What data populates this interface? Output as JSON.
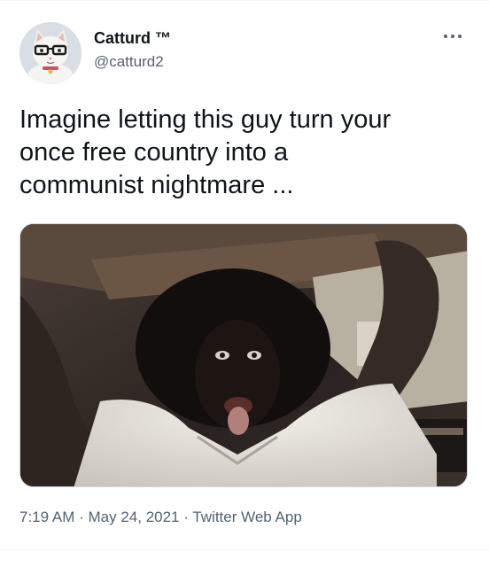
{
  "author": {
    "display_name": "Catturd ™",
    "handle": "@catturd2",
    "avatar_icon": "cat-with-glasses-avatar"
  },
  "more_icon": "more-options-icon",
  "tweet": {
    "text": "Imagine letting this guy turn your\nonce free country into a\ncommunist nightmare ..."
  },
  "media": {
    "type": "photo",
    "icon": "photo"
  },
  "meta": {
    "time": "7:19 AM",
    "separator": "·",
    "date": "May 24, 2021",
    "source": "Twitter Web App"
  },
  "colors": {
    "text_primary": "#0f1419",
    "text_secondary": "#536471",
    "border": "#cfd9de",
    "divider": "#eff3f4"
  }
}
